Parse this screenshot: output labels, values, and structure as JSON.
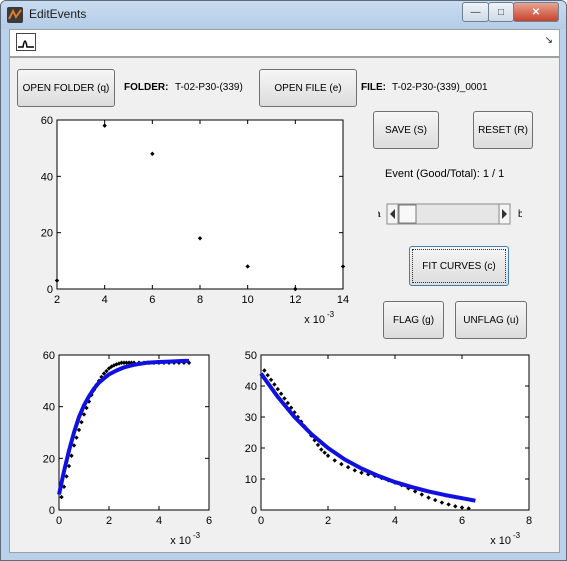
{
  "window": {
    "title": "EditEvents",
    "controls": [
      "—",
      "□",
      "✕"
    ]
  },
  "toolbar": {
    "plot_tool": "waveform-icon",
    "overflow": "↘"
  },
  "buttons": {
    "open_folder": "OPEN FOLDER (q)",
    "open_file": "OPEN FILE (e)",
    "save": "SAVE (S)",
    "reset": "RESET (R)",
    "fit_curves": "FIT CURVES (c)",
    "flag": "FLAG (g)",
    "unflag": "UNFLAG (u)"
  },
  "folder": {
    "label": "FOLDER:",
    "value": "T-02-P30-(339)"
  },
  "file": {
    "label": "FILE:",
    "value": "T-02-P30-(339)_0001"
  },
  "event_counter": "Event (Good/Total):  1 / 1",
  "slider": {
    "left_label": "a",
    "right_label": "b",
    "value_fraction": 0.0
  },
  "colors": {
    "fit_line": "#1010e0",
    "markers": "#000000"
  },
  "chart_data": [
    {
      "type": "scatter",
      "xlim": [
        2,
        14
      ],
      "ylim": [
        0,
        60
      ],
      "xticks": [
        "2",
        "4",
        "6",
        "8",
        "10",
        "12",
        "14"
      ],
      "yticks": [
        "0",
        "20",
        "40",
        "60"
      ],
      "x_exponent": "x 10",
      "x_exponent_power": "-3",
      "series": [
        {
          "x": [
            2,
            4,
            6,
            8,
            10,
            12,
            14
          ],
          "y": [
            3,
            58,
            48,
            18,
            8,
            0,
            8
          ]
        }
      ]
    },
    {
      "type": "line",
      "xlim": [
        0,
        6
      ],
      "ylim": [
        0,
        60
      ],
      "xticks": [
        "0",
        "2",
        "4",
        "6"
      ],
      "yticks": [
        "0",
        "20",
        "40",
        "60"
      ],
      "x_exponent": "x 10",
      "x_exponent_power": "-3",
      "series": [
        {
          "kind": "markers",
          "x": [
            0.1,
            0.2,
            0.3,
            0.4,
            0.5,
            0.6,
            0.7,
            0.8,
            0.9,
            1.0,
            1.1,
            1.2,
            1.3,
            1.4,
            1.5,
            1.6,
            1.7,
            1.8,
            1.9,
            2.0,
            2.1,
            2.2,
            2.3,
            2.4,
            2.5,
            2.6,
            2.7,
            2.8,
            2.9,
            3.0,
            3.2,
            3.4,
            3.6,
            3.8,
            4.0,
            4.2,
            4.4,
            4.6,
            4.8,
            5.0,
            5.2
          ],
          "y": [
            5,
            9,
            13,
            17,
            21,
            25,
            28,
            31,
            34,
            37,
            39.5,
            42,
            44.5,
            46.5,
            48.5,
            50,
            51.5,
            52.8,
            53.8,
            54.8,
            55.5,
            56,
            56.4,
            56.7,
            57,
            57,
            57,
            57,
            57,
            57,
            57,
            57,
            57,
            57,
            57,
            57,
            57,
            57,
            57,
            57,
            57
          ]
        },
        {
          "kind": "fit",
          "x": [
            0,
            0.2,
            0.4,
            0.6,
            0.8,
            1.0,
            1.2,
            1.4,
            1.6,
            1.8,
            2.0,
            2.3,
            2.6,
            3.0,
            3.5,
            4.0,
            4.5,
            5.0,
            5.2
          ],
          "y": [
            6,
            15,
            23,
            30,
            36,
            40.5,
            44,
            47,
            49.3,
            51,
            52.5,
            54,
            55.2,
            56.2,
            57,
            57.3,
            57.5,
            57.7,
            57.7
          ]
        }
      ]
    },
    {
      "type": "line",
      "xlim": [
        0,
        8
      ],
      "ylim": [
        0,
        50
      ],
      "xticks": [
        "0",
        "2",
        "4",
        "6",
        "8"
      ],
      "yticks": [
        "0",
        "10",
        "20",
        "30",
        "40",
        "50"
      ],
      "x_exponent": "x 10",
      "x_exponent_power": "-3",
      "series": [
        {
          "kind": "markers",
          "x": [
            0.1,
            0.2,
            0.3,
            0.4,
            0.5,
            0.6,
            0.7,
            0.8,
            0.9,
            1.0,
            1.1,
            1.2,
            1.3,
            1.4,
            1.5,
            1.6,
            1.7,
            1.8,
            1.9,
            2.0,
            2.2,
            2.4,
            2.6,
            2.8,
            3.0,
            3.2,
            3.4,
            3.6,
            3.8,
            4.0,
            4.2,
            4.4,
            4.6,
            4.8,
            5.0,
            5.2,
            5.4,
            5.6,
            5.8,
            6.0,
            6.2
          ],
          "y": [
            45,
            43.5,
            42,
            40.5,
            39,
            37.5,
            36,
            34.5,
            33,
            31.5,
            30,
            28.5,
            27,
            25.5,
            24,
            22.5,
            21,
            19.5,
            18.5,
            17.5,
            16,
            14.8,
            13.8,
            12.8,
            12,
            11.5,
            11,
            10.3,
            9.6,
            8.8,
            8,
            7,
            6,
            5,
            4,
            3.2,
            2.4,
            1.8,
            1.2,
            0.8,
            0.5
          ]
        },
        {
          "kind": "fit",
          "x": [
            0,
            0.5,
            1.0,
            1.5,
            2.0,
            2.5,
            3.0,
            3.5,
            4.0,
            4.5,
            5.0,
            5.5,
            6.0,
            6.4
          ],
          "y": [
            44,
            36.5,
            30,
            24.5,
            20,
            16.3,
            13.4,
            11,
            9,
            7.4,
            6,
            4.8,
            3.8,
            3
          ]
        }
      ]
    }
  ]
}
